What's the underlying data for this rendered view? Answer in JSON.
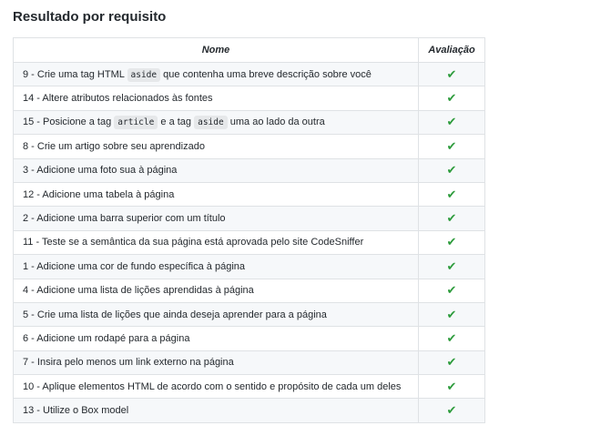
{
  "title": "Resultado por requisito",
  "columns": {
    "name": "Nome",
    "evaluation": "Avaliação"
  },
  "check_symbol": "✔",
  "check_color": "#2c9b3b",
  "rows": [
    {
      "segments": [
        {
          "t": "9 - Crie uma tag HTML "
        },
        {
          "code": "aside"
        },
        {
          "t": " que contenha uma breve descrição sobre você"
        }
      ],
      "status": "passed"
    },
    {
      "segments": [
        {
          "t": "14 - Altere atributos relacionados às fontes"
        }
      ],
      "status": "passed"
    },
    {
      "segments": [
        {
          "t": "15 - Posicione a tag "
        },
        {
          "code": "article"
        },
        {
          "t": " e a tag "
        },
        {
          "code": "aside"
        },
        {
          "t": " uma ao lado da outra"
        }
      ],
      "status": "passed"
    },
    {
      "segments": [
        {
          "t": "8 - Crie um artigo sobre seu aprendizado"
        }
      ],
      "status": "passed"
    },
    {
      "segments": [
        {
          "t": "3 - Adicione uma foto sua à página"
        }
      ],
      "status": "passed"
    },
    {
      "segments": [
        {
          "t": "12 - Adicione uma tabela à página"
        }
      ],
      "status": "passed"
    },
    {
      "segments": [
        {
          "t": "2 - Adicione uma barra superior com um título"
        }
      ],
      "status": "passed"
    },
    {
      "segments": [
        {
          "t": "11 - Teste se a semântica da sua página está aprovada pelo site CodeSniffer"
        }
      ],
      "status": "passed"
    },
    {
      "segments": [
        {
          "t": "1 - Adicione uma cor de fundo específica à página"
        }
      ],
      "status": "passed"
    },
    {
      "segments": [
        {
          "t": "4 - Adicione uma lista de lições aprendidas à página"
        }
      ],
      "status": "passed"
    },
    {
      "segments": [
        {
          "t": "5 - Crie uma lista de lições que ainda deseja aprender para a página"
        }
      ],
      "status": "passed"
    },
    {
      "segments": [
        {
          "t": "6 - Adicione um rodapé para a página"
        }
      ],
      "status": "passed"
    },
    {
      "segments": [
        {
          "t": "7 - Insira pelo menos um link externo na página"
        }
      ],
      "status": "passed"
    },
    {
      "segments": [
        {
          "t": "10 - Aplique elementos HTML de acordo com o sentido e propósito de cada um deles"
        }
      ],
      "status": "passed"
    },
    {
      "segments": [
        {
          "t": "13 - Utilize o Box model"
        }
      ],
      "status": "passed"
    }
  ]
}
